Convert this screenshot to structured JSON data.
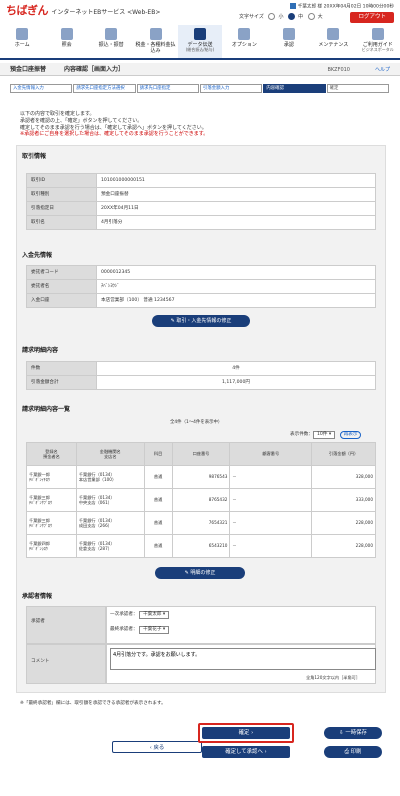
{
  "header": {
    "logo_main": "ちばぎん",
    "logo_sub": "インターネットEBサービス <Web-EB>",
    "user_line": "千葉太郎 様 20XX年04月02日 10時00分00秒",
    "font_size_label": "文字サイズ",
    "font_small": "小",
    "font_mid": "中",
    "font_large": "大",
    "logout": "ログアウト"
  },
  "nav": [
    {
      "label": "ホーム",
      "icon": "home-icon"
    },
    {
      "label": "照会",
      "icon": "inquiry-icon"
    },
    {
      "label": "振込・振替",
      "icon": "transfer-icon"
    },
    {
      "label": "税金・各種料金払込み",
      "icon": "tax-icon"
    },
    {
      "label": "データ伝送",
      "sub": "(総合振込/給与)",
      "icon": "data-transmission-icon",
      "selected": true
    },
    {
      "label": "オプション",
      "icon": "option-icon"
    },
    {
      "label": "承認",
      "icon": "approval-icon"
    },
    {
      "label": "メンテナンス",
      "icon": "maintenance-icon"
    },
    {
      "label": "ご利用ガイド",
      "sub": "ビジネスポータル",
      "icon": "guide-icon"
    }
  ],
  "title": {
    "service": "預金口座振替",
    "page": "内容確認［画面入力］",
    "code": "BKZF010",
    "help": "ヘルプ"
  },
  "steps": [
    "入金先情報入力",
    "請求先口座指定方法選択",
    "請求先口座指定",
    "引落金額入力",
    "内容確認",
    "確定"
  ],
  "intro": [
    "以下の内容で取引を確定します。",
    "承認者を確認の上、「確定」ボタンを押してください。",
    "確定してそのまま承認を行う場合は、「確定して承認へ」ボタンを押してください。",
    "※承認者にご自身を選択した場合は、確定してそのまま承認を行うことができます。"
  ],
  "transaction": {
    "heading": "取引情報",
    "rows": [
      {
        "k": "取引ID",
        "v": "101001000000151"
      },
      {
        "k": "取引種別",
        "v": "預金口座振替"
      },
      {
        "k": "引落指定日",
        "v": "20XX年04月11日"
      },
      {
        "k": "取引名",
        "v": "4月引落分"
      }
    ]
  },
  "payee": {
    "heading": "入金先情報",
    "rows": [
      {
        "k": "委託者コード",
        "v": "0000012345"
      },
      {
        "k": "委託者名",
        "v": "ﾁﾊﾞｼﾖｳｼﾞ"
      },
      {
        "k": "入金口座",
        "v": "本店営業部（100） 普通 1234567"
      }
    ],
    "edit_btn": "取引・入金先情報の修正"
  },
  "summary": {
    "heading": "請求明細内容",
    "rows": [
      {
        "k": "件数",
        "v": "4件"
      },
      {
        "k": "引落金額合計",
        "v": "1,117,000円"
      }
    ]
  },
  "list": {
    "heading": "請求明細内容一覧",
    "count_text": "全4件（1～4件を表示中）",
    "per_page_label": "表示件数：",
    "per_page": "10件",
    "go": "再表示",
    "cols": [
      "登録名\n預金者名",
      "金融機関名\n支店名",
      "科目",
      "口座番号",
      "顧客番号",
      "引落金額（円）"
    ],
    "rows": [
      [
        "千葉銀一郎\nﾁﾊﾞｷﾞﾝｲﾁﾛｳ",
        "千葉銀行（0134）\n本店営業部（100）",
        "普通",
        "9876543",
        "－",
        "328,000"
      ],
      [
        "千葉銀三郎\nﾁﾊﾞｷﾞﾝｻﾌﾞﾛｳ",
        "千葉銀行（0134）\n中央支店（061）",
        "普通",
        "8765432",
        "－",
        "333,000"
      ],
      [
        "千葉銀三郎\nﾁﾊﾞｷﾞﾝｻﾌﾞﾛｳ",
        "千葉銀行（0134）\n成田支店（266）",
        "普通",
        "7654321",
        "－",
        "228,000"
      ],
      [
        "千葉銀四郎\nﾁﾊﾞｷﾞﾝｼﾛｳ",
        "千葉銀行（0134）\n佐倉支店（287）",
        "普通",
        "6543210",
        "－",
        "228,000"
      ]
    ],
    "edit_btn": "明細の修正"
  },
  "approver": {
    "heading": "承認者情報",
    "label": "承認者",
    "first_label": "一次承認者：",
    "first": "千葉太郎",
    "final_label": "最終承認者：",
    "final": "千葉花子",
    "comment_label": "コメント",
    "comment": "4月引落分です。承認をお願いします。",
    "limit": "全角120文字以内［半角可］"
  },
  "note": "※「最終承認者」欄には、取引額を承認できる承認者が表示されます。",
  "buttons": {
    "back": "戻る",
    "confirm": "確定",
    "confirm_approve": "確定して承認へ",
    "save": "一時保存",
    "print": "印刷"
  }
}
